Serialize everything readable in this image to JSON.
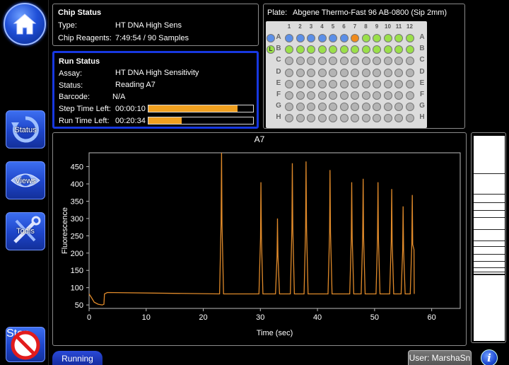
{
  "nav": {
    "status_label": "Status",
    "views_label": "Views",
    "tools_label": "Tools",
    "stop_label": "Stop"
  },
  "chip_status": {
    "title": "Chip Status",
    "type_label": "Type:",
    "type_value": "HT DNA High Sens",
    "reagents_label": "Chip Reagents:",
    "reagents_value": "7:49:54 / 90 Samples"
  },
  "run_status": {
    "title": "Run Status",
    "assay_label": "Assay:",
    "assay_value": "HT DNA High Sensitivity",
    "status_label": "Status:",
    "status_value": "Reading A7",
    "barcode_label": "Barcode:",
    "barcode_value": "N/A",
    "step_label": "Step Time Left:",
    "step_value": "00:00:10",
    "step_progress": 0.85,
    "run_label": "Run Time Left:",
    "run_value": "00:20:34",
    "run_progress": 0.32,
    "progress_color": "#f0a020"
  },
  "plate": {
    "label": "Plate:",
    "name": "Abgene Thermo-Fast 96 AB-0800 (Sip 2mm)",
    "columns": [
      "1",
      "2",
      "3",
      "4",
      "5",
      "6",
      "7",
      "8",
      "9",
      "10",
      "11",
      "12"
    ],
    "rows": [
      "A",
      "B",
      "C",
      "D",
      "E",
      "F",
      "G",
      "H"
    ],
    "row_a_left_marker": "A",
    "row_b_left_marker": "L",
    "colors": {
      "completed": "#5b8fe8",
      "current": "#f08a1a",
      "pending": "#9be04a",
      "empty": "#b4b4b4"
    },
    "row_states": {
      "A": [
        "completed",
        "completed",
        "completed",
        "completed",
        "completed",
        "completed",
        "current",
        "pending",
        "pending",
        "pending",
        "pending",
        "pending"
      ],
      "B": [
        "pending",
        "pending",
        "pending",
        "pending",
        "pending",
        "pending",
        "pending",
        "pending",
        "pending",
        "pending",
        "pending",
        "pending"
      ]
    }
  },
  "chart_data": {
    "type": "line",
    "title": "A7",
    "xlabel": "Time (sec)",
    "ylabel": "Fluorescence",
    "xlim": [
      0,
      65
    ],
    "ylim": [
      40,
      490
    ],
    "xticks": [
      0,
      10,
      20,
      30,
      40,
      50,
      60
    ],
    "yticks": [
      50,
      100,
      150,
      200,
      250,
      300,
      350,
      400,
      450
    ],
    "line_color": "#e08a2a",
    "baseline": 82,
    "peaks": [
      {
        "x": 23.2,
        "y": 490
      },
      {
        "x": 30.1,
        "y": 405
      },
      {
        "x": 33.0,
        "y": 300
      },
      {
        "x": 35.6,
        "y": 460
      },
      {
        "x": 38.0,
        "y": 465
      },
      {
        "x": 42.2,
        "y": 440
      },
      {
        "x": 46.0,
        "y": 405
      },
      {
        "x": 48.0,
        "y": 415
      },
      {
        "x": 50.6,
        "y": 405
      },
      {
        "x": 53.0,
        "y": 385
      },
      {
        "x": 55.0,
        "y": 335
      },
      {
        "x": 56.6,
        "y": 368
      }
    ],
    "grid": false
  },
  "footer": {
    "running_label": "Running",
    "user_label": "User: MarshaSn",
    "info_label": "i"
  }
}
